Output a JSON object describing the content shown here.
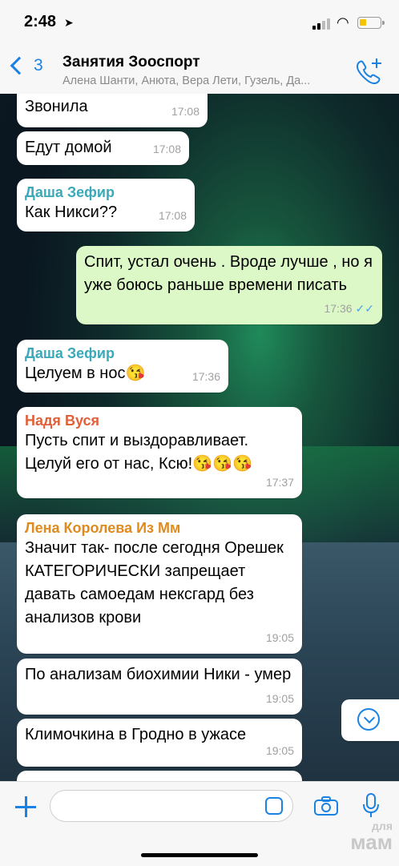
{
  "status": {
    "time": "2:48",
    "location_icon": "location-arrow-icon"
  },
  "header": {
    "back_count": "3",
    "title": "Занятия Зооспорт",
    "subtitle": "Алена Шанти, Анюта, Вера Лети, Гузель, Да..."
  },
  "messages": [
    {
      "sender": "",
      "text": "Звонила",
      "time": "17:08"
    },
    {
      "sender": "",
      "text": "Едут домой",
      "time": "17:08"
    },
    {
      "sender": "Даша Зефир",
      "sender_color": "#3aa9b9",
      "text": "Как Никси??",
      "time": "17:08"
    },
    {
      "sender": "",
      "text": "Спит, устал очень . Вроде лучше , но я уже боюсь раньше времени писать",
      "time": "17:36",
      "outgoing": true
    },
    {
      "sender": "Даша Зефир",
      "sender_color": "#3aa9b9",
      "text": "Целуем в нос😘",
      "time": "17:36"
    },
    {
      "sender": "Надя Вуся",
      "sender_color": "#e0603a",
      "text": "Пусть спит и выздоравливает. Целуй его от нас, Ксю!😘😘😘",
      "time": "17:37"
    },
    {
      "sender": "Лена Королева Из Мм",
      "sender_color": "#e08a1e",
      "text": "Значит так- после сегодня Орешек КАТЕГОРИЧЕСКИ запрещает давать самоедам нексгард без анализов крови",
      "time": "19:05"
    },
    {
      "sender": "",
      "text": "По анализам биохимии Ники - умер",
      "time": "19:05"
    },
    {
      "sender": "",
      "text": "Климочкина в Гродно в ужасе",
      "time": "19:05"
    }
  ],
  "input": {
    "placeholder": ""
  },
  "watermark": {
    "top": "для",
    "bottom": "мам"
  },
  "colors": {
    "accent": "#1a82e2",
    "outgoing_bubble": "#dcf8c6",
    "read_ticks": "#4fa3e0"
  }
}
